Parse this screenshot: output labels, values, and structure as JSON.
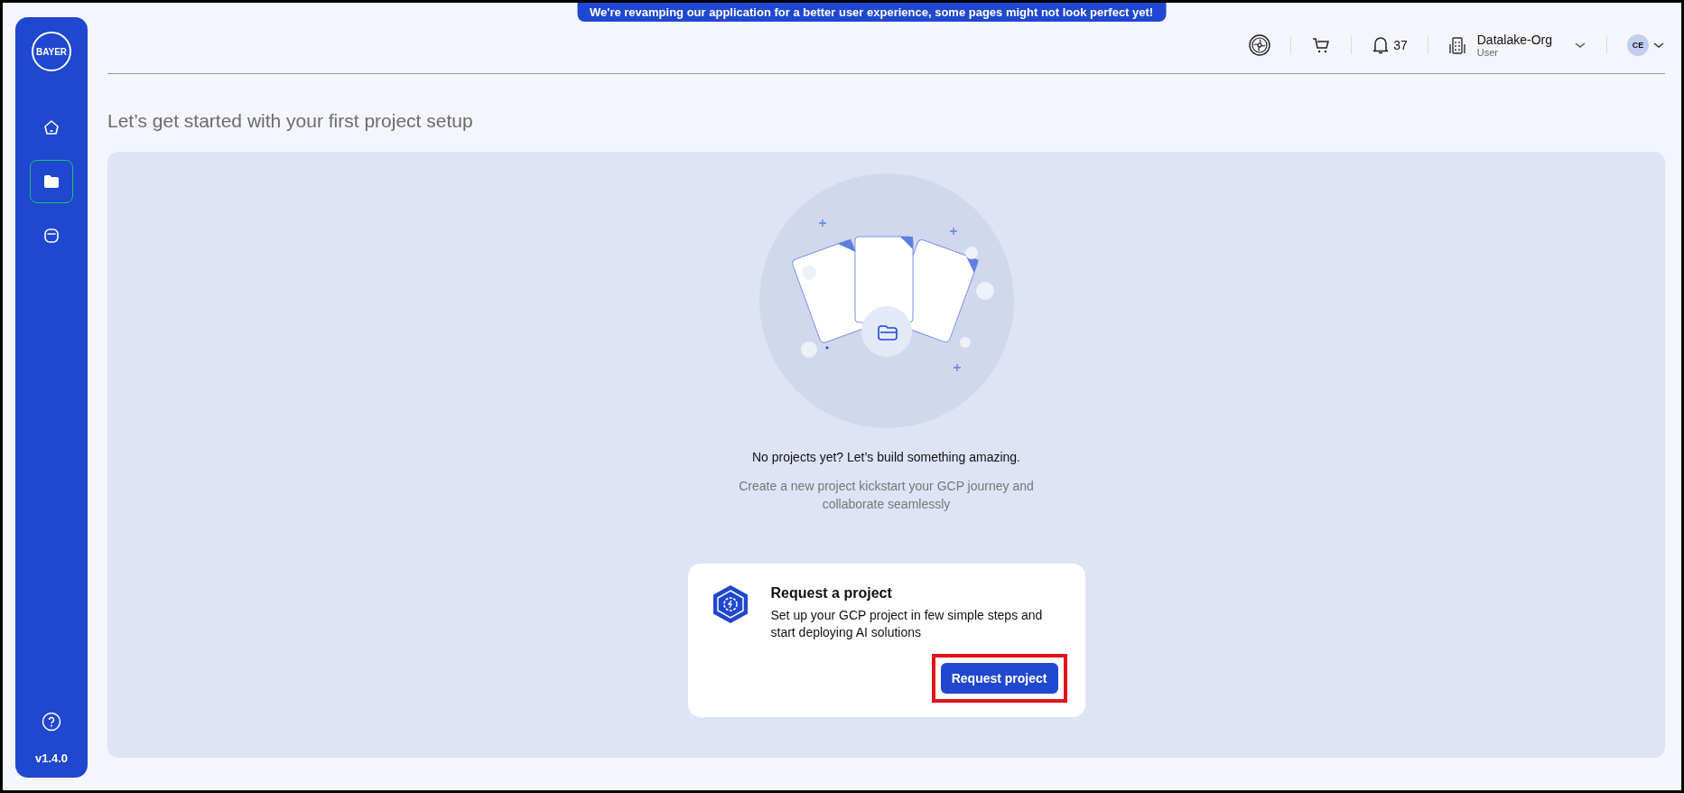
{
  "banner": {
    "text": "We're revamping our application for a better user experience, some pages might not look perfect yet!"
  },
  "sidebar": {
    "logo": "BAYER",
    "nav_items": [
      {
        "kind": "home",
        "selected": false
      },
      {
        "kind": "projects",
        "selected": true
      },
      {
        "kind": "bag",
        "selected": false
      }
    ],
    "version": "v1.4.0"
  },
  "header": {
    "notifications": "37",
    "org": {
      "name": "Datalake-Org",
      "role": "User"
    },
    "avatar": "CE"
  },
  "page_title": "Let’s get started with your first project setup",
  "empty_state": {
    "title": "No projects yet? Let’s build something amazing.",
    "subtitle": "Create a new project kickstart your GCP journey and collaborate seamlessly"
  },
  "card": {
    "title": "Request a project",
    "description": "Set up your GCP project in few simple steps and start deploying AI solutions",
    "button": "Request project",
    "highlighted": true
  }
}
